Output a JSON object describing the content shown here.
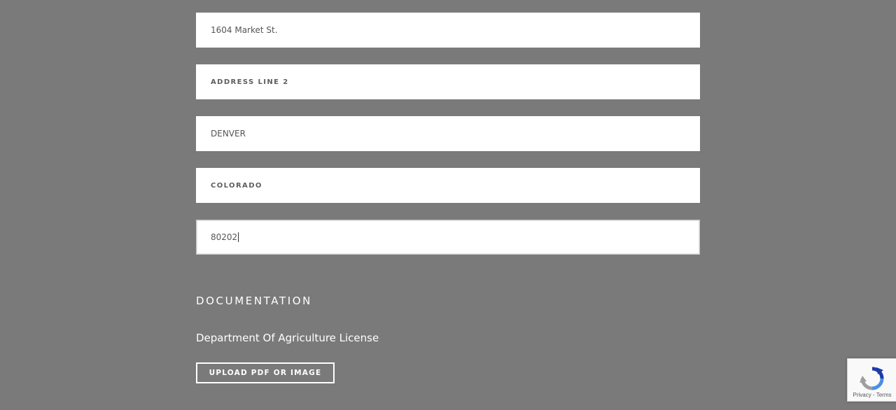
{
  "address_form": {
    "address_line_1": {
      "value": "1604 Market St."
    },
    "address_line_2": {
      "placeholder": "ADDRESS LINE 2"
    },
    "city": {
      "value": "DENVER"
    },
    "state": {
      "value": "COLORADO"
    },
    "zip": {
      "value": "80202"
    }
  },
  "documentation": {
    "section_title": "DOCUMENTATION",
    "document_label": "Department Of Agriculture License",
    "upload_button_label": "UPLOAD PDF OR IMAGE"
  },
  "recaptcha": {
    "icon": "recaptcha-icon",
    "privacy_label": "Privacy",
    "separator": " - ",
    "terms_label": "Terms"
  },
  "colors": {
    "overlay_background": "#7a7a7a",
    "field_background": "#ffffff",
    "recaptcha_blue": "#1c3aa9",
    "recaptcha_grey": "#9e9e9e"
  }
}
